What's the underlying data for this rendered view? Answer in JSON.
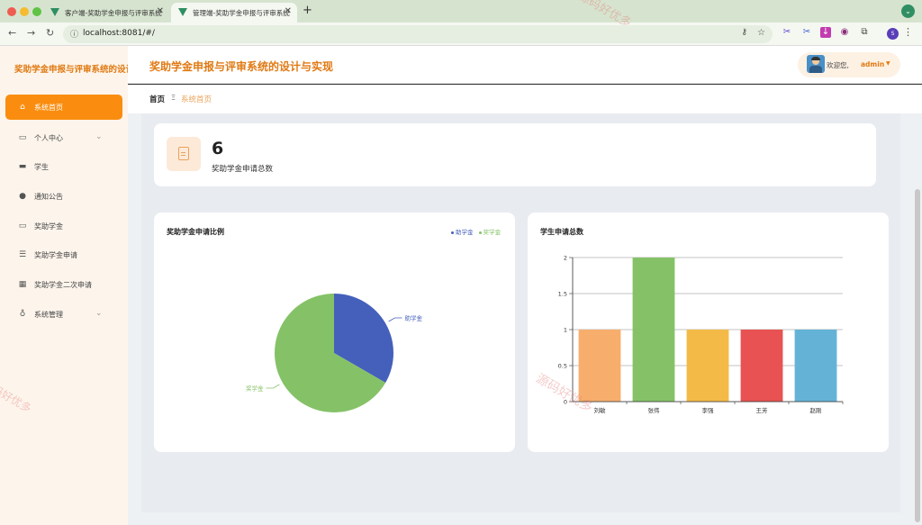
{
  "browser": {
    "tabs": [
      {
        "title": "客户端-奖助学金申报与评审系统"
      },
      {
        "title": "管理端-奖助学金申报与评审系统"
      }
    ],
    "url": "localhost:8081/#/",
    "profile_initial": "S"
  },
  "sidebar": {
    "title": "奖助学金申报与评审系统的设计",
    "items": [
      {
        "label": "系统首页",
        "icon": "home-icon",
        "active": true
      },
      {
        "label": "个人中心",
        "icon": "card-icon",
        "expandable": true
      },
      {
        "label": "学生",
        "icon": "chat-icon"
      },
      {
        "label": "通知公告",
        "icon": "pin-icon"
      },
      {
        "label": "奖助学金",
        "icon": "id-icon"
      },
      {
        "label": "奖助学金申请",
        "icon": "list-icon"
      },
      {
        "label": "奖助学金二次申请",
        "icon": "grid-icon"
      },
      {
        "label": "系统管理",
        "icon": "mic-icon",
        "expandable": true
      }
    ]
  },
  "header": {
    "title": "奖助学金申报与评审系统的设计与实现",
    "welcome": "欢迎您,",
    "username": "admin"
  },
  "breadcrumb": {
    "home": "首页",
    "separator": "Ξ",
    "current": "系统首页"
  },
  "stat": {
    "value": "6",
    "label": "奖助学金申请总数"
  },
  "watermark": "源码好优多",
  "colors": {
    "accent": "#fa8d0f",
    "title": "#e07a14"
  },
  "chart_data": [
    {
      "type": "pie",
      "title": "奖助学金申请比例",
      "legend_position": "top-right",
      "labels": [
        "助学金",
        "奖学金"
      ],
      "values": [
        2,
        4
      ],
      "colors": [
        "#4560bb",
        "#85c267"
      ]
    },
    {
      "type": "bar",
      "title": "学生申请总数",
      "categories": [
        "刘敏",
        "张伟",
        "李强",
        "王芳",
        "赵刚"
      ],
      "values": [
        1,
        2,
        1,
        1,
        1
      ],
      "colors": [
        "#f7ae6d",
        "#85c267",
        "#f4ba47",
        "#e85252",
        "#64b3d6"
      ],
      "ylim": [
        0,
        2
      ],
      "yticks": [
        "0",
        "0.5",
        "1",
        "1.5",
        "2"
      ],
      "grid": true
    }
  ]
}
